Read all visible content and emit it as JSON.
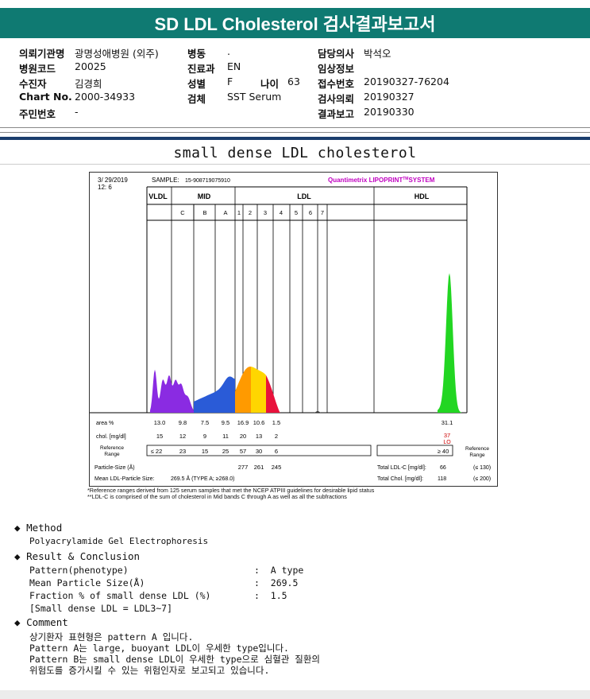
{
  "report_title": "SD LDL Cholesterol 검사결과보고서",
  "header": {
    "col1": [
      {
        "label": "의뢰기관명",
        "value": "광명성애병원 (외주)"
      },
      {
        "label": "병원코드",
        "value": "20025"
      },
      {
        "label": "수진자",
        "value": "김경희"
      },
      {
        "label": "Chart No.",
        "value": "2000-34933"
      },
      {
        "label": "주민번호",
        "value": "-"
      }
    ],
    "col2": [
      {
        "label": "병동",
        "value": "."
      },
      {
        "label": "진료과",
        "value": "EN"
      },
      {
        "label": "성별",
        "value": "F"
      },
      {
        "label": "검체",
        "value": "SST Serum"
      }
    ],
    "age": {
      "label": "나이",
      "value": "63"
    },
    "col3": [
      {
        "label": "담당의사",
        "value": "박석오"
      },
      {
        "label": "임상정보",
        "value": ""
      },
      {
        "label": "접수번호",
        "value": "20190327-76204"
      },
      {
        "label": "검사의뢰",
        "value": "20190327"
      },
      {
        "label": "결과보고",
        "value": "20190330"
      }
    ]
  },
  "subtitle": "small dense LDL cholesterol",
  "chart": {
    "date": "3/ 29/2019",
    "time": "12: 6",
    "sample_label": "SAMPLE:",
    "sample_id": "15-908719075910",
    "brand": "Quantimetrix LIPOPRINT",
    "brand_tm": "TM",
    "brand_suffix": "SYSTEM",
    "groups": [
      "VLDL",
      "MID",
      "LDL",
      "HDL"
    ],
    "bands": [
      "C",
      "B",
      "A",
      "1",
      "2",
      "3",
      "4",
      "5",
      "6",
      "7"
    ],
    "row_labels": [
      "area %",
      "chol. [mg/dl]",
      "Reference Range",
      "Particle-Size (Å)",
      "Mean LDL-Particle Size:"
    ],
    "area": [
      "13.0",
      "9.8",
      "7.5",
      "9.5",
      "16.9",
      "10.6",
      "1.5"
    ],
    "area_hdl": "31.1",
    "chol": [
      "15",
      "12",
      "9",
      "11",
      "20",
      "13",
      "2"
    ],
    "chol_hdl": "37",
    "chol_hdl_flag": "LO",
    "ref": [
      "≤ 22",
      "23",
      "15",
      "25",
      "57",
      "30",
      "6"
    ],
    "ref_hdl": "≥ 40",
    "ref_side_label": "Reference Range",
    "particle_sizes": [
      "277",
      "261",
      "245"
    ],
    "mean_size": "269.5 Å  (TYPE A; ≥268.0)",
    "total_ldl_label": "Total LDL-C [mg/dl]:",
    "total_ldl": "66",
    "total_ldl_ref": "(≤ 130)",
    "total_chol_label": "Total Chol. [mg/dl]:",
    "total_chol": "118",
    "total_chol_ref": "(≤ 200)"
  },
  "chart_data": {
    "type": "area",
    "title": "",
    "xlabel": "",
    "ylabel": "",
    "categories": [
      "VLDL",
      "MID C",
      "MID B",
      "MID A",
      "LDL1",
      "LDL2",
      "LDL3",
      "LDL4",
      "LDL5",
      "LDL6",
      "LDL7",
      "HDL"
    ],
    "series": [
      {
        "values": [
          13.0,
          9.8,
          7.5,
          9.5,
          16.9,
          10.6,
          1.5,
          0,
          0,
          0,
          0,
          31.1
        ]
      }
    ],
    "colors": {
      "vldl": "#8a2be2",
      "mid": "#2a5bd7",
      "ldl1": "#ff9a00",
      "ldl2": "#ffd600",
      "ldl3": "#e8123c",
      "hdl": "#22d622"
    }
  },
  "notes": [
    "*Reference ranges derived from 125 serum samples that met the NCEP ATPIII guidelines for desirable lipid status",
    "**LDL-C is comprised of the sum of cholesterol in Mid bands C through A as well as all the subfractions"
  ],
  "method": {
    "heading": "Method",
    "text": "Polyacrylamide Gel Electrophoresis"
  },
  "result": {
    "heading": "Result & Conclusion",
    "rows": [
      {
        "label": "Pattern(phenotype)",
        "value": "A type"
      },
      {
        "label": "Mean Particle Size(Å)",
        "value": "269.5"
      },
      {
        "label": "Fraction % of small dense LDL (%)",
        "value": "1.5"
      }
    ],
    "note": "[Small dense LDL = LDL3~7]"
  },
  "comment": {
    "heading": "Comment",
    "lines": [
      "상기환자 표현형은 pattern A 입니다.",
      "Pattern A는 large, buoyant LDL이 우세한 type입니다.",
      "Pattern B는 small dense LDL이 우세한 type으로 심혈관 질환의",
      "위험도를 증가시킬 수 있는 위험인자로 보고되고 있습니다."
    ]
  }
}
